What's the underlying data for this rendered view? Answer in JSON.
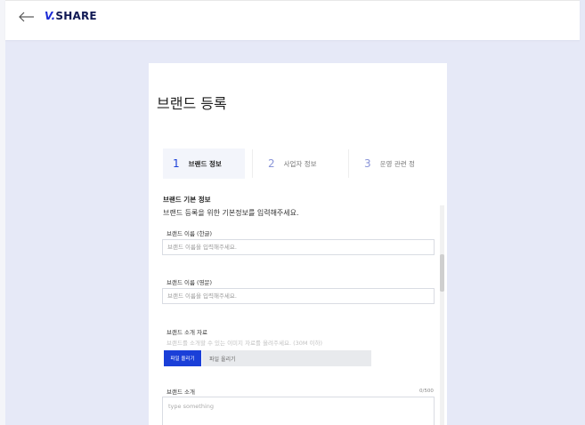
{
  "header": {
    "logo_mark": "V.",
    "logo_text": "SHARE"
  },
  "page": {
    "title": "브랜드 등록"
  },
  "steps": [
    {
      "number": "1",
      "label": "브랜드 정보",
      "active": true
    },
    {
      "number": "2",
      "label": "사업자 정보",
      "active": false
    },
    {
      "number": "3",
      "label": "운영 관련 정",
      "active": false
    }
  ],
  "section": {
    "title": "브랜드 기본 정보",
    "description": "브랜드 등록을 위한 기본정보를 입력해주세요."
  },
  "fields": {
    "name_ko": {
      "label": "브랜드 이름 (한글)",
      "placeholder": "브랜드 이름을 입력해주세요."
    },
    "name_en": {
      "label": "브랜드 이름 (영문)",
      "placeholder": "브랜드 이름을 입력해주세요."
    },
    "intro_material": {
      "label": "브랜드 소개 자료",
      "hint": "브랜드를 소개할 수 있는 이미지 자료를 올려주세요. (30M 이하)",
      "button": "파일 올리기",
      "field_text": "파일 올리기"
    },
    "intro": {
      "label": "브랜드 소개",
      "counter": "0/500",
      "placeholder": "type something"
    }
  },
  "colors": {
    "accent": "#1a3fd8",
    "background": "#e6e9f7",
    "brand_dark": "#111a55"
  }
}
